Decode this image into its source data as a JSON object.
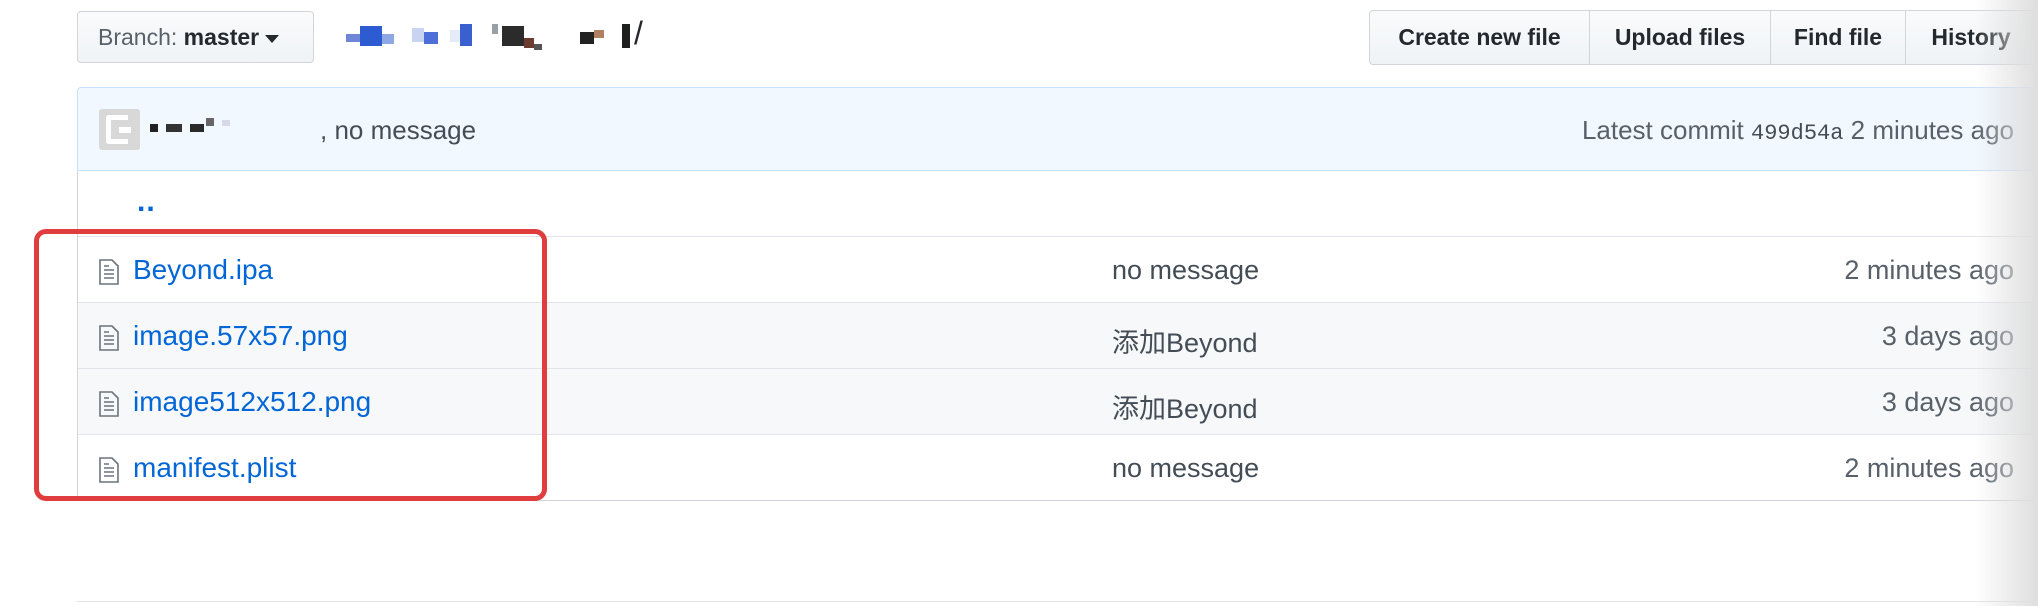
{
  "branch": {
    "label": "Branch:",
    "name": "master"
  },
  "breadcrumb": {
    "separator": "/"
  },
  "actions": [
    {
      "label": "Create new file"
    },
    {
      "label": "Upload files"
    },
    {
      "label": "Find file"
    },
    {
      "label": "History"
    }
  ],
  "commit": {
    "message": ", no message",
    "latest_label": "Latest commit",
    "sha": "499d54a",
    "time": "2 minutes ago"
  },
  "parent_dir": "..",
  "files": [
    {
      "name": "Beyond.ipa",
      "message": "no message",
      "age": "2 minutes ago"
    },
    {
      "name": "image.57x57.png",
      "message": "添加Beyond",
      "age": "3 days ago"
    },
    {
      "name": "image512x512.png",
      "message": "添加Beyond",
      "age": "3 days ago"
    },
    {
      "name": "manifest.plist",
      "message": "no message",
      "age": "2 minutes ago"
    }
  ],
  "colors": {
    "link": "#0366d6",
    "commit_bar_bg": "#f1f8ff",
    "highlight": "#e03e3e"
  },
  "icons": [
    "caret-down-icon",
    "file-icon"
  ]
}
